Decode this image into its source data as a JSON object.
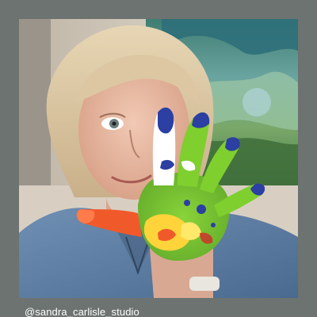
{
  "post": {
    "handle": "@sandra_carlisle_studio",
    "background_color": "#6c7370",
    "photo": {
      "subject": "woman-holding-up-paint-covered-hand",
      "paint_colors": [
        "#7fcf2e",
        "#2c3fa2",
        "#ffd43a",
        "#f05a2a",
        "#ffffff"
      ]
    }
  }
}
